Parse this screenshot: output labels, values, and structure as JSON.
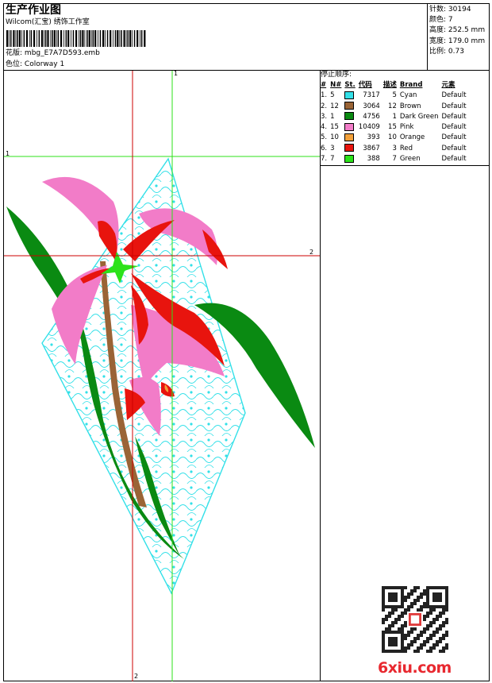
{
  "header": {
    "title": "生产作业图",
    "subtitle": "Wilcom(汇宝) 绣饰工作室",
    "design_label": "花版:",
    "design_file": "mbg_E7A7D593.emb",
    "colorway_label": "色位:",
    "colorway": "Colorway 1"
  },
  "stats": [
    {
      "label": "针数:",
      "value": "30194"
    },
    {
      "label": "颜色:",
      "value": "7"
    },
    {
      "label": "高度:",
      "value": "252.5 mm"
    },
    {
      "label": "宽度:",
      "value": "179.0 mm"
    },
    {
      "label": "比例:",
      "value": "0.73"
    }
  ],
  "legend": {
    "title": "停止顺序:",
    "columns": [
      "#",
      "N#",
      "St.",
      "代码",
      "描述",
      "Brand",
      "元素"
    ],
    "rows": [
      {
        "order": "1.",
        "n": "5",
        "stitches": "7317",
        "code": "5",
        "name": "Cyan",
        "brand": "Default",
        "color": "#33e0e8"
      },
      {
        "order": "2.",
        "n": "12",
        "stitches": "3064",
        "code": "12",
        "name": "Brown",
        "brand": "Default",
        "color": "#9a6436"
      },
      {
        "order": "3.",
        "n": "1",
        "stitches": "4756",
        "code": "1",
        "name": "Dark Green",
        "brand": "Default",
        "color": "#0a8a12"
      },
      {
        "order": "4.",
        "n": "15",
        "stitches": "10409",
        "code": "15",
        "name": "Pink",
        "brand": "Default",
        "color": "#f27cc8"
      },
      {
        "order": "5.",
        "n": "10",
        "stitches": "393",
        "code": "10",
        "name": "Orange",
        "brand": "Default",
        "color": "#f2a03a"
      },
      {
        "order": "6.",
        "n": "3",
        "stitches": "3867",
        "code": "3",
        "name": "Red",
        "brand": "Default",
        "color": "#e8140e"
      },
      {
        "order": "7.",
        "n": "7",
        "stitches": "388",
        "code": "7",
        "name": "Green",
        "brand": "Default",
        "color": "#2ce21a"
      }
    ]
  },
  "guides": {
    "vertical_green_label": "1",
    "horizontal_green_label": "1",
    "horizontal_red_label": "2",
    "vertical_red_label": "2"
  },
  "watermark": {
    "site": "6xiu.com"
  }
}
